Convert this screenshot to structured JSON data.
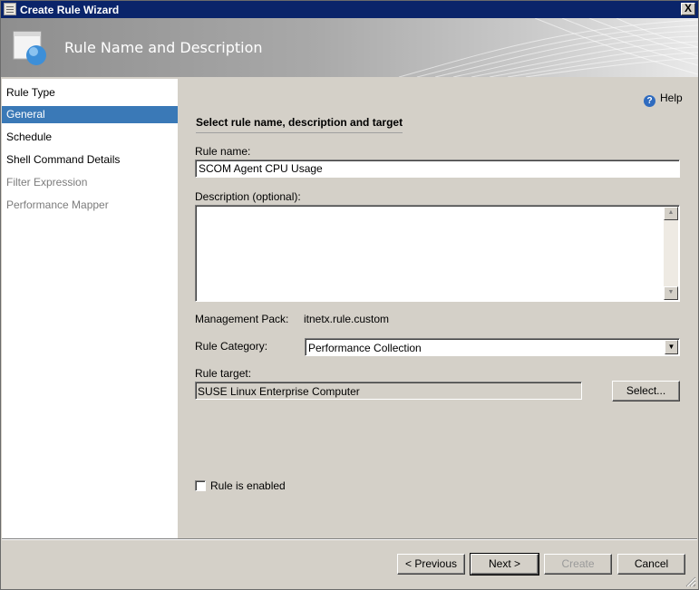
{
  "window": {
    "title": "Create Rule Wizard",
    "close_label": "X"
  },
  "banner": {
    "title": "Rule Name and Description"
  },
  "nav": {
    "items": [
      {
        "label": "Rule Type",
        "state": "normal"
      },
      {
        "label": "General",
        "state": "selected"
      },
      {
        "label": "Schedule",
        "state": "normal"
      },
      {
        "label": "Shell Command Details",
        "state": "normal"
      },
      {
        "label": "Filter Expression",
        "state": "disabled"
      },
      {
        "label": "Performance Mapper",
        "state": "disabled"
      }
    ]
  },
  "content": {
    "help_label": "Help",
    "section_title": "Select rule name, description and target",
    "rule_name_label": "Rule name:",
    "rule_name_value": "SCOM Agent CPU Usage",
    "description_label": "Description (optional):",
    "description_value": "",
    "management_pack_label": "Management Pack:",
    "management_pack_value": "itnetx.rule.custom",
    "rule_category_label": "Rule Category:",
    "rule_category_value": "Performance Collection",
    "rule_target_label": "Rule target:",
    "rule_target_value": "SUSE Linux Enterprise Computer",
    "select_button_label": "Select...",
    "rule_enabled_label": "Rule is enabled",
    "rule_enabled_checked": false
  },
  "footer": {
    "previous_label": "< Previous",
    "next_label": "Next >",
    "create_label": "Create",
    "cancel_label": "Cancel"
  },
  "colors": {
    "title_bar": "#0a246a",
    "nav_selected": "#3a79b7",
    "window_bg": "#d4d0c8"
  }
}
